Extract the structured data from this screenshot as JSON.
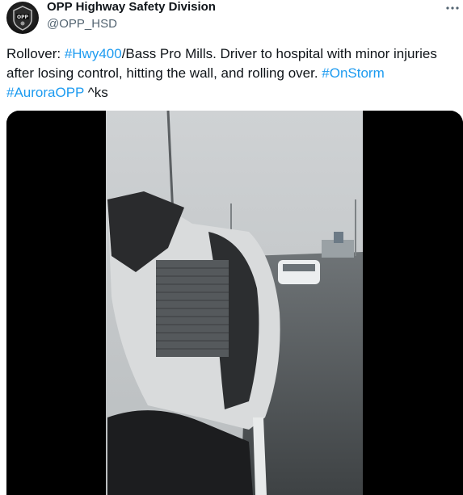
{
  "author": {
    "display_name": "OPP Highway Safety Division",
    "handle": "@OPP_HSD",
    "avatar_icon": "opp-badge-avatar"
  },
  "more_icon": "more-horizontal-icon",
  "tweet": {
    "t1": "Rollover: ",
    "tag_hwy400": "#Hwy400",
    "t2": "/Bass Pro Mills. Driver to hospital with minor injuries after losing control, hitting the wall, and rolling over. ",
    "tag_onstorm": "#OnStorm",
    "t3": " ",
    "tag_auroraopp": "#AuroraOPP",
    "t4": " ^ks"
  },
  "media": {
    "type": "video-still",
    "description_icon": "video-thumbnail"
  },
  "colors": {
    "link": "#1d9bf0",
    "text": "#0f1419",
    "secondary": "#536471"
  }
}
